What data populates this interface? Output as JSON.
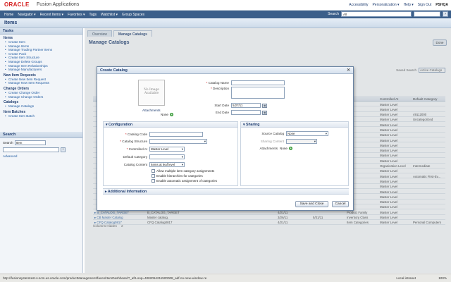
{
  "header": {
    "logo": "ORACLE",
    "app_name": "Fusion Applications",
    "links": [
      "Accessibility",
      "Personalization ▾",
      "Help ▾",
      "Sign Out",
      "PSHQA"
    ]
  },
  "nav": {
    "items": [
      "Home",
      "Navigator ▾",
      "Recent Items ▾",
      "Favorites ▾",
      "Tags",
      "Watchlist ▾",
      "Group Spaces"
    ],
    "search_label": "Search",
    "search_scope": "All"
  },
  "page_title": "Items",
  "left_panel": {
    "tasks_title": "Tasks",
    "sections": [
      {
        "title": "Items",
        "links": [
          "Create Item",
          "Manage Items",
          "Manage Trading Partner Items",
          "Create Pack",
          "Create Item Structure",
          "Manage Delete Groups",
          "Manage Item Relationships",
          "Manage Manufacturers"
        ]
      },
      {
        "title": "New Item Requests",
        "links": [
          "Create New Item Request",
          "Manage New Item Requests"
        ]
      },
      {
        "title": "Change Orders",
        "links": [
          "Create Change Order",
          "Manage Change Orders"
        ]
      },
      {
        "title": "Catalogs",
        "links": [
          "Manage Catalogs"
        ]
      },
      {
        "title": "Item Batches",
        "links": [
          "Create Item Batch"
        ]
      }
    ],
    "search_title": "Search",
    "search_label": "Search",
    "search_type": "Item",
    "advanced_label": "Advanced"
  },
  "main": {
    "tabs": [
      "Overview",
      "Manage Catalogs"
    ],
    "title": "Manage Catalogs",
    "done_label": "Done",
    "saved_search_label": "Saved Search",
    "saved_search_value": "Active Catalogs",
    "table_header": [
      "",
      "",
      "",
      "",
      "",
      "",
      "Controlled At",
      "Default Category"
    ],
    "table_rows": [
      [
        "",
        "",
        "",
        "",
        "",
        "",
        "Master Level",
        ""
      ],
      [
        "",
        "",
        "",
        "",
        "",
        "",
        "Master Level",
        ""
      ],
      [
        "",
        "",
        "",
        "",
        "",
        "",
        "Master Level",
        "49112000"
      ],
      [
        "",
        "",
        "",
        "",
        "",
        "",
        "Master Level",
        "Uncategorized"
      ],
      [
        "",
        "",
        "",
        "",
        "",
        "",
        "Master Level",
        ""
      ],
      [
        "",
        "",
        "",
        "",
        "",
        "",
        "Master Level",
        ""
      ],
      [
        "",
        "",
        "",
        "",
        "",
        "",
        "Master Level",
        ""
      ],
      [
        "",
        "",
        "",
        "",
        "",
        "",
        "Master Level",
        ""
      ],
      [
        "",
        "",
        "",
        "",
        "",
        "",
        "Master Level",
        ""
      ],
      [
        "",
        "",
        "",
        "",
        "",
        "",
        "Master Level",
        ""
      ],
      [
        "",
        "",
        "",
        "",
        "",
        "",
        "Master Level",
        ""
      ],
      [
        "",
        "",
        "",
        "",
        "",
        "",
        "Master Level",
        ""
      ],
      [
        "",
        "",
        "",
        "",
        "",
        "",
        "Organization Level",
        "Intermediate"
      ],
      [
        "",
        "",
        "",
        "",
        "",
        "",
        "Master Level",
        ""
      ],
      [
        "",
        "",
        "",
        "",
        "",
        "",
        "Master Level",
        "Automatic First-Ev..."
      ],
      [
        "",
        "",
        "",
        "",
        "",
        "",
        "Master Level",
        ""
      ],
      [
        "",
        "",
        "",
        "",
        "",
        "",
        "Master Level",
        ""
      ],
      [
        "",
        "",
        "",
        "",
        "",
        "",
        "Master Level",
        ""
      ],
      [
        "",
        "",
        "",
        "",
        "",
        "",
        "Master Level",
        ""
      ],
      [
        "",
        "",
        "",
        "",
        "",
        "",
        "Master Level",
        ""
      ],
      [
        "",
        "",
        "",
        "",
        "",
        "",
        "Master Level",
        ""
      ],
      [
        "▸ B_CATALOG_TARGET",
        "B_CATALOG_TARGET",
        "",
        "4/21/11",
        "",
        "Product Family",
        "Master Level",
        ""
      ],
      [
        "▸ CB Master Catalog",
        "Master catalog.",
        "",
        "3/26/11",
        "5/31/11",
        "Inventory Class",
        "Master Level",
        ""
      ],
      [
        "▸ CFQ Catalog0817",
        "CFQ Catalog0817",
        "",
        "4/21/11",
        "",
        "Item Categories",
        "Master Level",
        "Personal Computers"
      ]
    ],
    "columns_hidden_label": "Columns Hidden",
    "columns_hidden_count": "2"
  },
  "dialog": {
    "title": "Create Catalog",
    "close": "✕",
    "no_image": "No Image Available",
    "attachments_label": "Attachments",
    "attachments_value": "None",
    "catalog_name_label": "Catalog Name",
    "description_label": "Description",
    "start_date_label": "Start Date",
    "start_date_value": "5/27/11",
    "end_date_label": "End Date",
    "configuration": {
      "title": "Configuration",
      "catalog_code_label": "Catalog Code",
      "catalog_structure_label": "Catalog Structure",
      "controlled_at_label": "Controlled At",
      "controlled_at_value": "Master Level",
      "default_category_label": "Default Category",
      "catalog_content_label": "Catalog Content",
      "catalog_content_value": "Items at leaf level",
      "checkboxes": [
        "Allow multiple item category assignments",
        "Enable hierarchies for categories",
        "Enable automatic assignment of categories"
      ]
    },
    "sharing": {
      "title": "Sharing",
      "source_catalog_label": "Source Catalog",
      "source_catalog_value": "None",
      "sharing_content_label": "Sharing Content",
      "attachments_label": "Attachments",
      "attachments_value": "None"
    },
    "additional_info": "Additional Information",
    "save_close": "Save and Close",
    "cancel": "Cancel"
  },
  "status_bar": {
    "url": "http://fusionsystemtest-s-scm.us.oracle.com/productManagement/faces/ItemDashboard?_afrLoop=4082054211500008_adf.no-new-window-re",
    "zone": "Local intranet",
    "zoom": "100%"
  }
}
